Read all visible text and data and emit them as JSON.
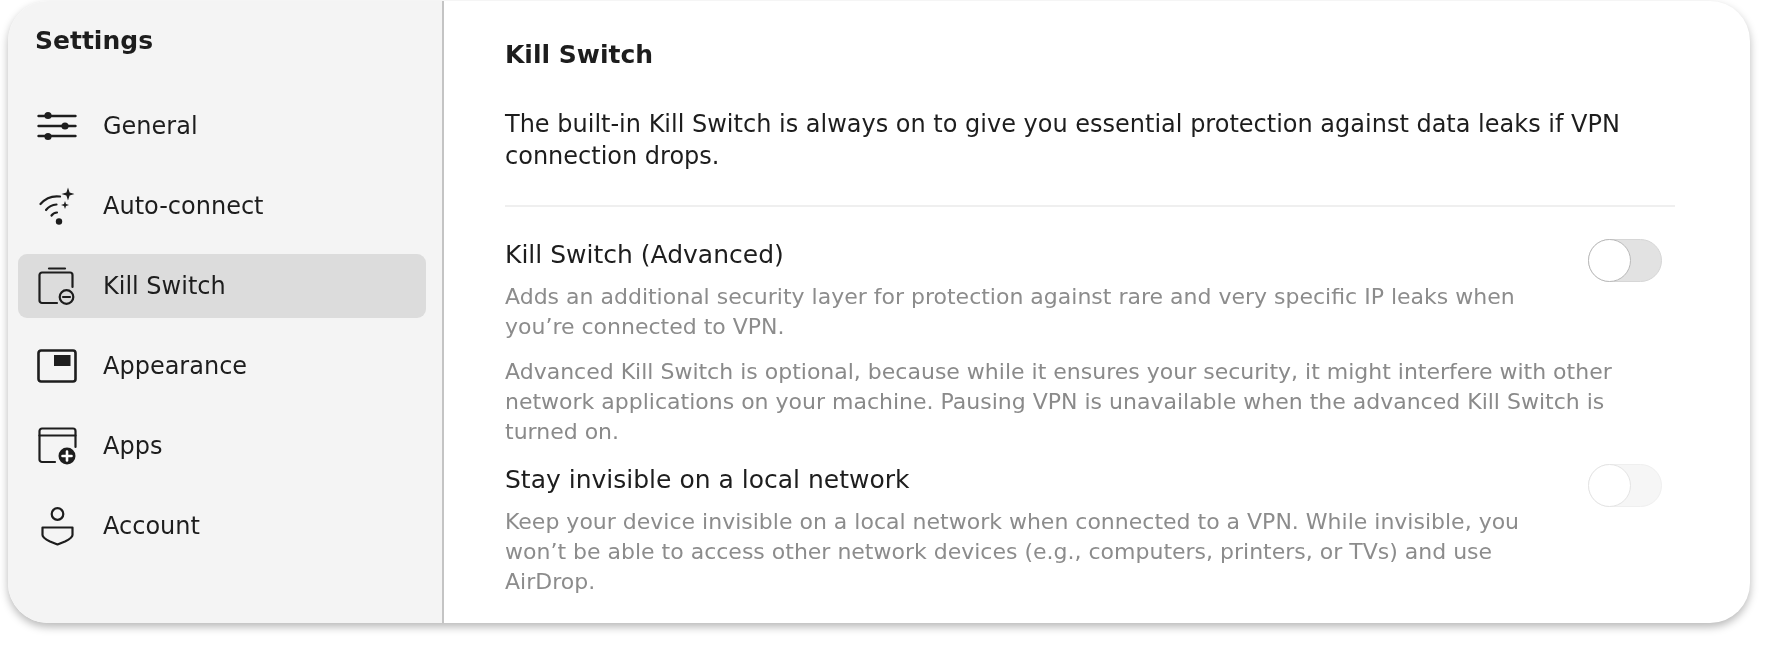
{
  "sidebar": {
    "title": "Settings",
    "items": [
      {
        "label": "General",
        "selected": false
      },
      {
        "label": "Auto-connect",
        "selected": false
      },
      {
        "label": "Kill Switch",
        "selected": true
      },
      {
        "label": "Appearance",
        "selected": false
      },
      {
        "label": "Apps",
        "selected": false
      },
      {
        "label": "Account",
        "selected": false
      }
    ]
  },
  "content": {
    "title": "Kill Switch",
    "intro": "The built-in Kill Switch is always on to give you essential protection against data leaks if VPN connection drops.",
    "settings": [
      {
        "kind": "toggle",
        "label": "Kill Switch (Advanced)",
        "description": "Adds an additional security layer for protection against rare and very specific IP leaks when you’re connected to VPN.",
        "on": false,
        "disabled": false
      },
      {
        "kind": "note",
        "text": "Advanced Kill Switch is optional, because while it ensures your security, it might interfere with other network applications on your machine. Pausing VPN is unavailable when the advanced Kill Switch is turned on."
      },
      {
        "kind": "toggle",
        "label": "Stay invisible on a local network",
        "description": "Keep your device invisible on a local network when connected to a VPN. While invisible, you won’t be able to access other network devices (e.g., computers, printers, or TVs) and use AirDrop.",
        "on": false,
        "disabled": true
      }
    ]
  }
}
